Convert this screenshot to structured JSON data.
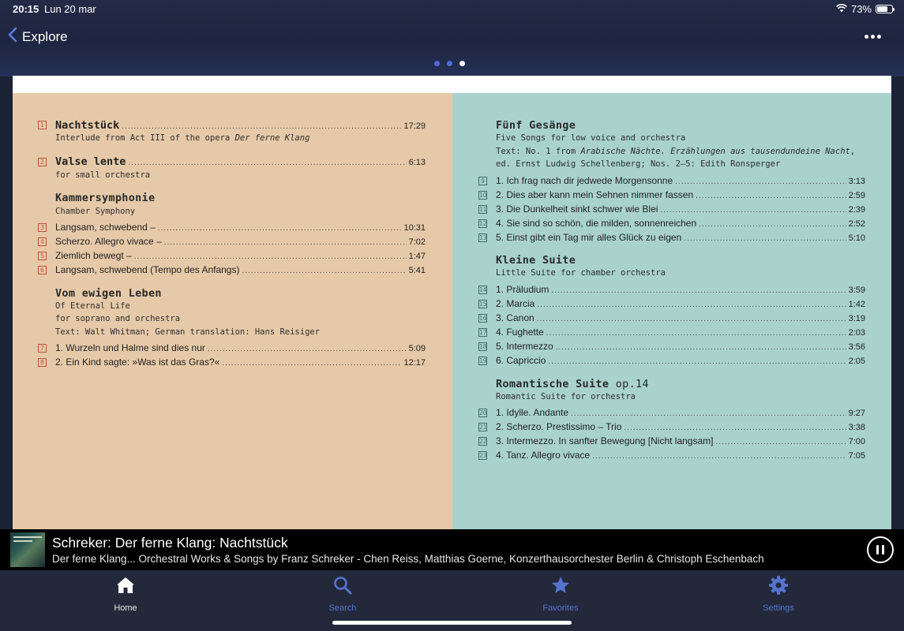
{
  "status": {
    "time": "20:15",
    "date": "Lun 20 mar",
    "battery": "73%",
    "battery_level": 0.73
  },
  "nav": {
    "back_label": "Explore"
  },
  "pager": {
    "count": 3,
    "active": 3
  },
  "booklet": {
    "left": {
      "nachtstuck": {
        "num": "1",
        "title": "Nachtstück",
        "duration": "17:29",
        "sub_plain": "Interlude from Act III of the opera ",
        "sub_italic": "Der ferne Klang"
      },
      "valse": {
        "num": "2",
        "title": "Valse lente",
        "duration": "6:13",
        "sub": "for small orchestra"
      },
      "kammer": {
        "title": "Kammersymphonie",
        "sub": "Chamber Symphony",
        "tracks": [
          {
            "num": "3",
            "title": "Langsam, schwebend –",
            "duration": "10:31"
          },
          {
            "num": "4",
            "title": "Scherzo. Allegro vivace –",
            "duration": "7:02"
          },
          {
            "num": "5",
            "title": "Ziemlich bewegt –",
            "duration": "1:47"
          },
          {
            "num": "6",
            "title": "Langsam, schwebend (Tempo des Anfangs)",
            "duration": "5:41"
          }
        ]
      },
      "ewigen": {
        "title": "Vom ewigen Leben",
        "sub1": "Of Eternal Life",
        "sub2": "for soprano and orchestra",
        "sub3": "Text: Walt Whitman; German translation: Hans Reisiger",
        "tracks": [
          {
            "num": "7",
            "title": "1. Wurzeln und Halme sind dies nur",
            "duration": "5:09"
          },
          {
            "num": "8",
            "title": "2. Ein Kind sagte: »Was ist das Gras?«",
            "duration": "12:17"
          }
        ]
      }
    },
    "right": {
      "gesange": {
        "title": "Fünf Gesänge",
        "sub1": "Five Songs for low voice and orchestra",
        "text_a": "Text: No. 1 from ",
        "text_a_italic": "Arabische Nächte. Erzählungen aus tausendundeine Nacht",
        "text_a_end": ",",
        "text_b": "ed. Ernst Ludwig Schellenberg; Nos. 2–5: Edith Ronsperger",
        "tracks": [
          {
            "num": "9",
            "title": "1. Ich frag nach dir jedwede Morgensonne",
            "duration": "3:13"
          },
          {
            "num": "10",
            "title": "2. Dies aber kann mein Sehnen nimmer fassen",
            "duration": "2:59"
          },
          {
            "num": "11",
            "title": "3. Die Dunkelheit sinkt schwer wie Blei",
            "duration": "2:39"
          },
          {
            "num": "12",
            "title": "4. Sie sind so schön, die milden, sonnenreichen",
            "duration": "2:52"
          },
          {
            "num": "13",
            "title": "5. Einst gibt ein Tag mir alles Glück zu eigen",
            "duration": "5:10"
          }
        ]
      },
      "kleine": {
        "title": "Kleine Suite",
        "sub": "Little Suite for chamber orchestra",
        "tracks": [
          {
            "num": "14",
            "title": "1. Präludium",
            "duration": "3:59"
          },
          {
            "num": "15",
            "title": "2. Marcia",
            "duration": "1:42"
          },
          {
            "num": "16",
            "title": "3. Canon",
            "duration": "3:19"
          },
          {
            "num": "17",
            "title": "4. Fughette",
            "duration": "2:03"
          },
          {
            "num": "18",
            "title": "5. Intermezzo",
            "duration": "3:56"
          },
          {
            "num": "19",
            "title": "6. Capriccio",
            "duration": "2:05"
          }
        ]
      },
      "romantische": {
        "title": "Romantische Suite",
        "opus": " op.14",
        "sub": "Romantic Suite for orchestra",
        "tracks": [
          {
            "num": "20",
            "title": "1. Idylle. Andante",
            "duration": "9:27"
          },
          {
            "num": "21",
            "title": "2. Scherzo. Prestissimo – Trio",
            "duration": "3:38"
          },
          {
            "num": "22",
            "title": "3. Intermezzo. In sanfter Bewegung [Nicht langsam]",
            "duration": "7:00"
          },
          {
            "num": "23",
            "title": "4. Tanz. Allegro vivace",
            "duration": "7:05"
          }
        ]
      }
    }
  },
  "now_playing": {
    "title": "Schreker: Der ferne Klang: Nachtstück",
    "subtitle": "Der ferne Klang... Orchestral Works & Songs by Franz Schreker - Chen Reiss, Matthias Goerne, Konzerthausorchester Berlin & Christoph Eschenbach"
  },
  "tabs": {
    "home": "Home",
    "search": "Search",
    "favorites": "Favorites",
    "settings": "Settings"
  },
  "colors": {
    "accent": "#4c6bd3",
    "left_panel": "#e6c9a8",
    "right_panel": "#a9d2cd",
    "tab_bar": "#23293b"
  }
}
